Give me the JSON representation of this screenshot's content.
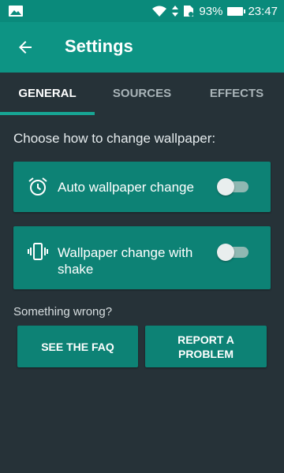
{
  "status_bar": {
    "battery": "93%",
    "time": "23:47",
    "icons": [
      "image-icon",
      "wifi-icon",
      "data-arrows-icon",
      "sim-icon",
      "battery-icon"
    ]
  },
  "app_bar": {
    "title": "Settings",
    "back_icon": "arrow-left-icon"
  },
  "tabs": [
    {
      "label": "GENERAL",
      "active": true
    },
    {
      "label": "SOURCES",
      "active": false
    },
    {
      "label": "EFFECTS",
      "active": false
    }
  ],
  "general": {
    "hint": "Choose how to change wallpaper:",
    "options": [
      {
        "label": "Auto wallpaper change",
        "icon": "alarm-clock-icon",
        "enabled": false
      },
      {
        "label_line1": "Wallpaper change with",
        "label_line2": "shake",
        "icon": "vibrate-phone-icon",
        "enabled": false
      }
    ],
    "help_text": "Something wrong?",
    "faq_button": "SEE THE FAQ",
    "report_button_line1": "REPORT A",
    "report_button_line2": "PROBLEM"
  },
  "colors": {
    "background": "#263238",
    "app_bar": "#0d9484",
    "status_bar": "#0a8a7b",
    "card": "#0d8275",
    "accent": "#17a594"
  }
}
